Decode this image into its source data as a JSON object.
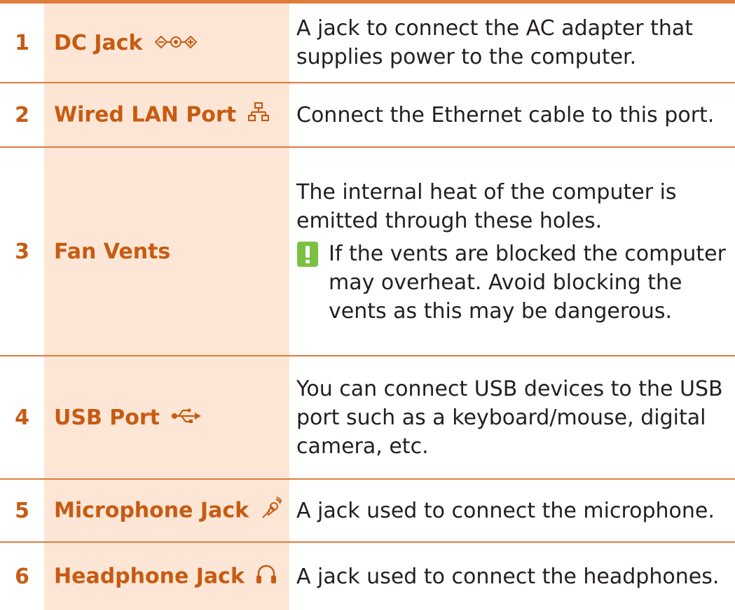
{
  "colors": {
    "accent": "#e07b39",
    "name_column_bg": "#fde6d6",
    "label_text": "#c75b12",
    "body_text": "#231f20",
    "note_icon": "#7ac143"
  },
  "rows": [
    {
      "number": "1",
      "name": "DC Jack",
      "icon": "dc-jack-icon",
      "description": "A jack to connect the AC adapter that supplies power to the computer."
    },
    {
      "number": "2",
      "name": "Wired LAN Port",
      "icon": "lan-port-icon",
      "description": "Connect the Ethernet cable to this port."
    },
    {
      "number": "3",
      "name": "Fan Vents",
      "icon": "",
      "description": "The internal heat of the computer is emitted through these holes.",
      "note": {
        "icon": "caution-icon",
        "text": "If the vents are blocked the computer may overheat. Avoid blocking the vents as this may be dangerous."
      }
    },
    {
      "number": "4",
      "name": "USB Port",
      "icon": "usb-icon",
      "description": "You can connect USB devices to the USB port such as a keyboard/mouse, digital camera, etc."
    },
    {
      "number": "5",
      "name": "Microphone Jack",
      "icon": "microphone-icon",
      "description": "A jack used to connect the microphone."
    },
    {
      "number": "6",
      "name": "Headphone Jack",
      "icon": "headphone-icon",
      "description": "A jack used to connect the headphones."
    }
  ]
}
